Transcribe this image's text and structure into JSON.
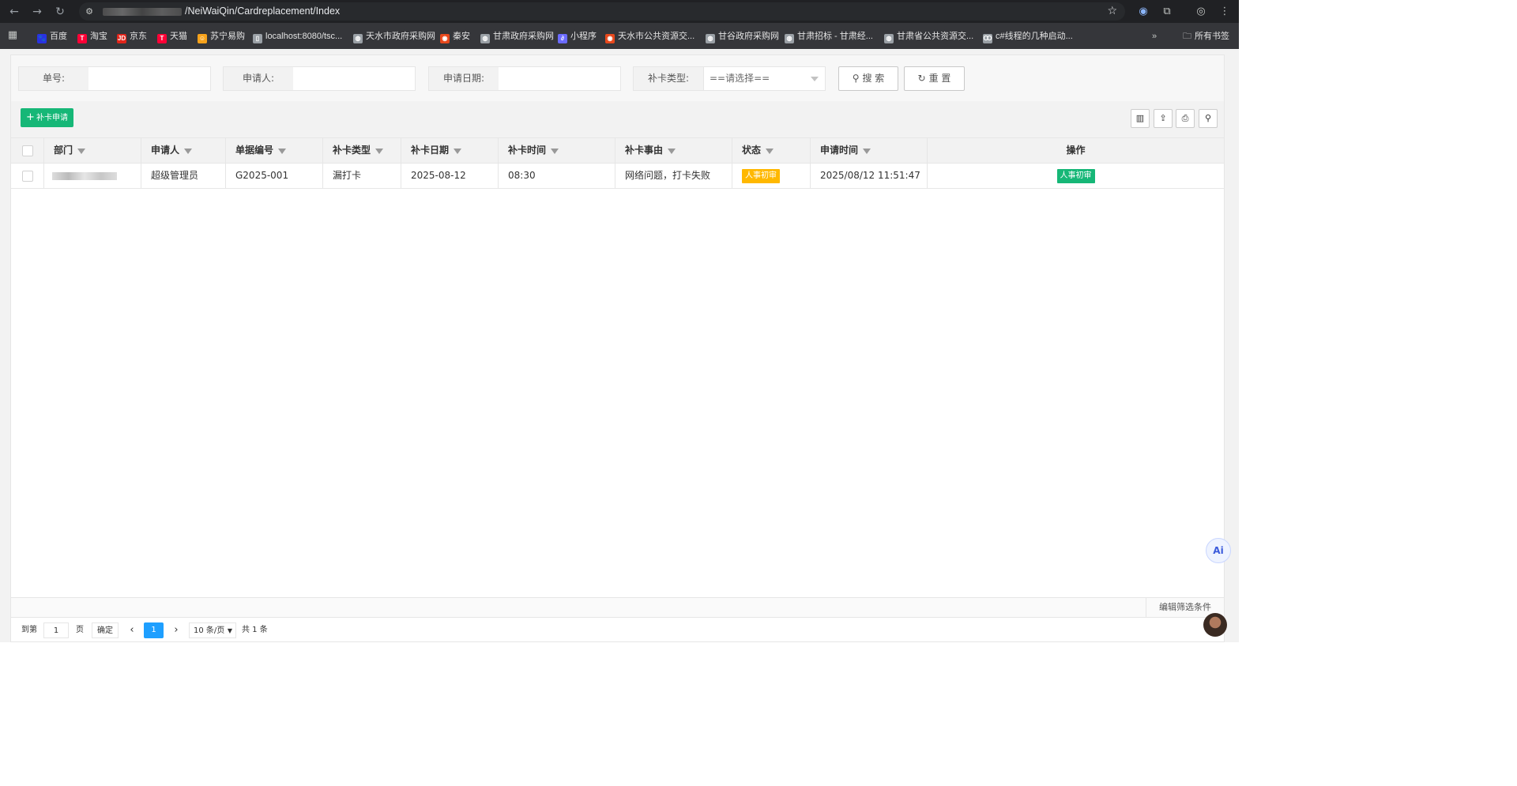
{
  "browser": {
    "url_visible": "/NeiWaiQin/Cardreplacement/Index",
    "bookmarks": [
      {
        "label": "百度",
        "color": "#2932e1",
        "glyph": "🐾"
      },
      {
        "label": "淘宝",
        "color": "#ff0036",
        "glyph": "T"
      },
      {
        "label": "京东",
        "color": "#e1251b",
        "glyph": "JD"
      },
      {
        "label": "天猫",
        "color": "#ff0036",
        "glyph": "T"
      },
      {
        "label": "苏宁易购",
        "color": "#f7a21b",
        "glyph": "☺"
      },
      {
        "label": "localhost:8080/tsc...",
        "color": "#9aa0a6",
        "glyph": "▯"
      },
      {
        "label": "天水市政府采购网",
        "color": "#9aa0a6",
        "glyph": "◍"
      },
      {
        "label": "秦安",
        "color": "#e8491d",
        "glyph": "◉"
      },
      {
        "label": "甘肃政府采购网",
        "color": "#9aa0a6",
        "glyph": "◍"
      },
      {
        "label": "小程序",
        "color": "#6b6bff",
        "glyph": "∂"
      },
      {
        "label": "天水市公共资源交...",
        "color": "#e8491d",
        "glyph": "◉"
      },
      {
        "label": "甘谷政府采购网",
        "color": "#9aa0a6",
        "glyph": "◍"
      },
      {
        "label": "甘肃招标 - 甘肃经...",
        "color": "#9aa0a6",
        "glyph": "◍"
      },
      {
        "label": "甘肃省公共资源交...",
        "color": "#9aa0a6",
        "glyph": "◍"
      },
      {
        "label": "c#线程的几种启动...",
        "color": "#9aa0a6",
        "glyph": "Ꝏ"
      }
    ],
    "all_bookmarks_label": "所有书签"
  },
  "search": {
    "order_no_label": "单号:",
    "applicant_label": "申请人:",
    "apply_date_label": "申请日期:",
    "card_type_label": "补卡类型:",
    "card_type_value": "==请选择==",
    "search_button": "搜 索",
    "reset_button": "重 置"
  },
  "toolbar": {
    "add_button": "补卡申请"
  },
  "table": {
    "columns": [
      "部门",
      "申请人",
      "单据编号",
      "补卡类型",
      "补卡日期",
      "补卡时间",
      "补卡事由",
      "状态",
      "申请时间",
      "操作"
    ],
    "rows": [
      {
        "applicant": "超级管理员",
        "doc_no": "G2025-001",
        "card_type": "漏打卡",
        "card_date": "2025-08-12",
        "card_time": "08:30",
        "reason": "网络问题，打卡失败",
        "status": "人事初审",
        "status_color": "#ffb800",
        "apply_time": "2025/08/12 11:51:47",
        "action": "人事初审",
        "action_color": "#16b777"
      }
    ]
  },
  "footer": {
    "edit_filter": "编辑筛选条件"
  },
  "pager": {
    "goto_label": "到第",
    "page_value": "1",
    "page_unit": "页",
    "confirm": "确定",
    "current_page": "1",
    "page_size": "10 条/页",
    "total": "共 1 条"
  },
  "float": {
    "ai_label": "Ai"
  }
}
